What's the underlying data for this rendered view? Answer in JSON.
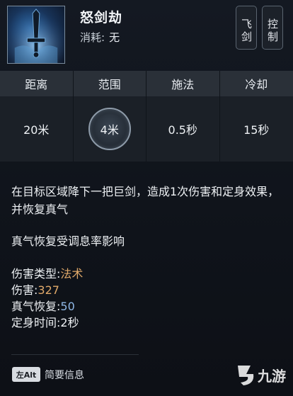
{
  "skill": {
    "name": "怒剑劫",
    "cost_label": "消耗:",
    "cost_value": "无",
    "tags": [
      "飞剑",
      "控制"
    ]
  },
  "stats": {
    "headers": [
      "距离",
      "范围",
      "施法",
      "冷却"
    ],
    "values": [
      "20米",
      "4米",
      "0.5秒",
      "15秒"
    ]
  },
  "description": {
    "line1": "在目标区域降下一把巨剑，造成1次伤害和定身效果，并恢复真气",
    "line2": "真气恢复受调息率影响"
  },
  "attributes": [
    {
      "label": "伤害类型:",
      "value": "法术",
      "color": "#e0a96a"
    },
    {
      "label": "伤害:",
      "value": "327",
      "color": "#e0a96a"
    },
    {
      "label": "真气恢复:",
      "value": "50",
      "color": "#8fb8e6"
    },
    {
      "label": "定身时间:",
      "value": "2秒",
      "color": "#eef1f4"
    }
  ],
  "footer": {
    "key": "左Alt",
    "label": "简要信息"
  },
  "watermark": "九游"
}
